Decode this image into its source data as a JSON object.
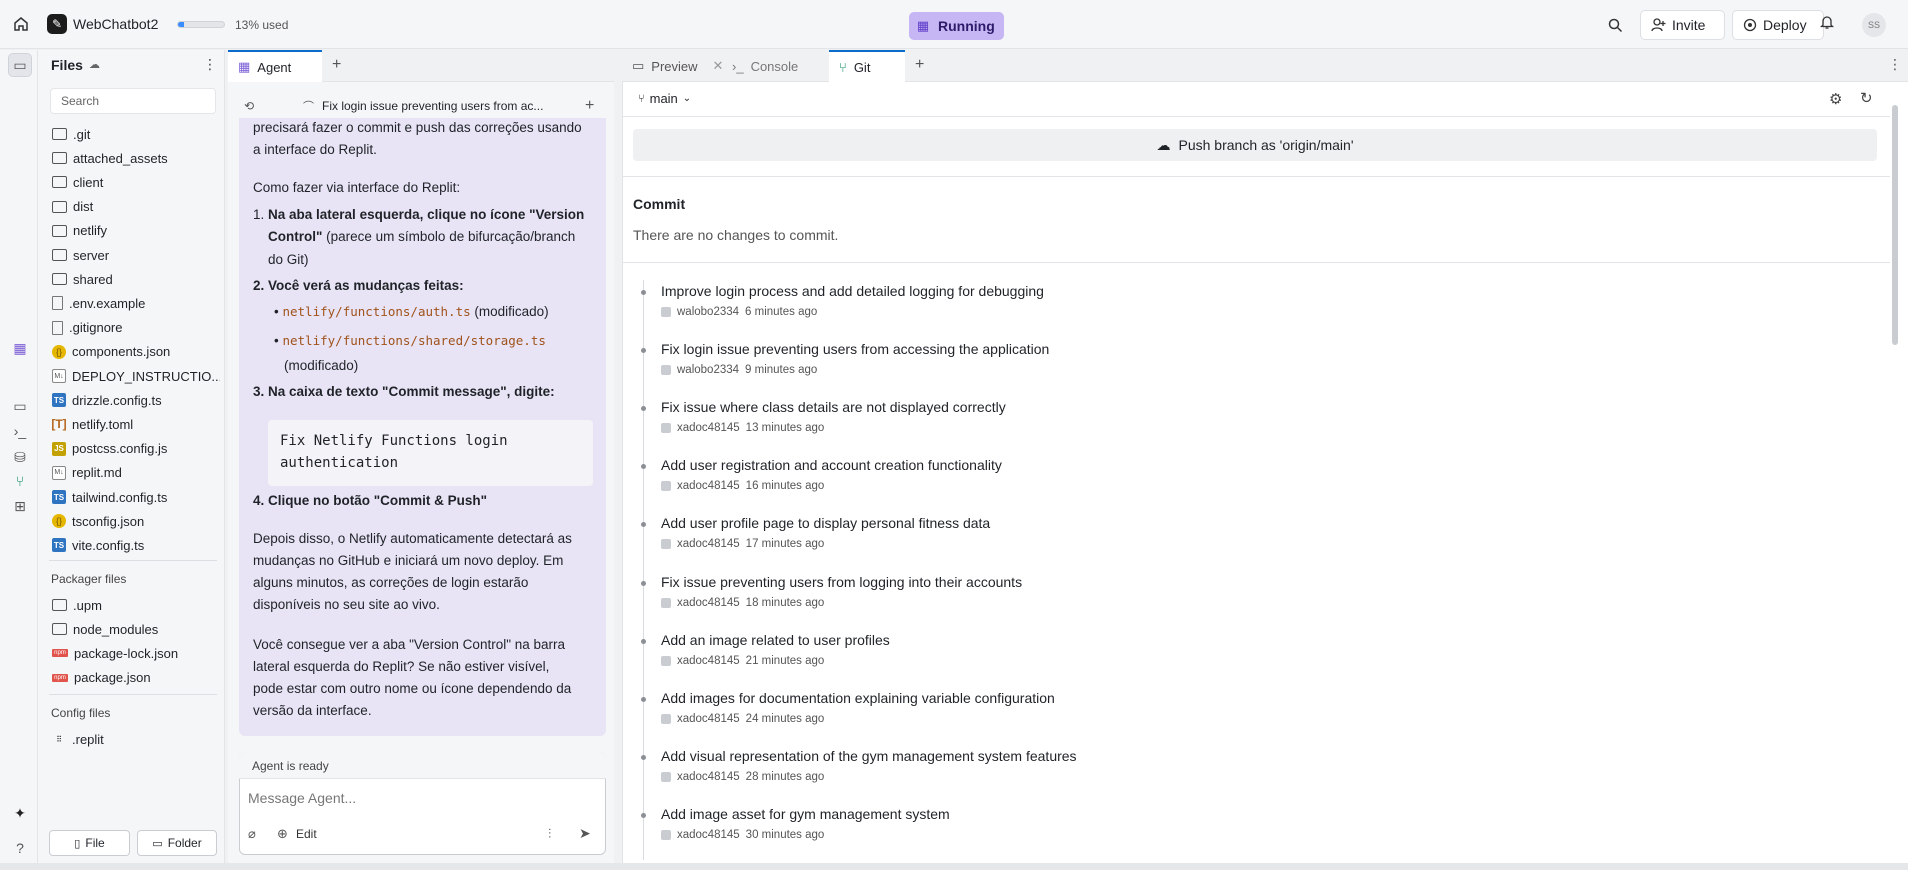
{
  "topbar": {
    "app_name": "WebChatbot2",
    "usage_text": "13% used",
    "usage_fraction": 0.13,
    "status": "Running",
    "invite": "Invite",
    "deploy": "Deploy",
    "avatar": "SS"
  },
  "files": {
    "title": "Files",
    "search_placeholder": "Search",
    "items": [
      {
        "name": ".git",
        "type": "folder"
      },
      {
        "name": "attached_assets",
        "type": "folder"
      },
      {
        "name": "client",
        "type": "folder"
      },
      {
        "name": "dist",
        "type": "folder"
      },
      {
        "name": "netlify",
        "type": "folder"
      },
      {
        "name": "server",
        "type": "folder"
      },
      {
        "name": "shared",
        "type": "folder"
      },
      {
        "name": ".env.example",
        "type": "file"
      },
      {
        "name": ".gitignore",
        "type": "file"
      },
      {
        "name": "components.json",
        "type": "json"
      },
      {
        "name": "DEPLOY_INSTRUCTIO...",
        "type": "md"
      },
      {
        "name": "drizzle.config.ts",
        "type": "ts"
      },
      {
        "name": "netlify.toml",
        "type": "toml"
      },
      {
        "name": "postcss.config.js",
        "type": "js"
      },
      {
        "name": "replit.md",
        "type": "md"
      },
      {
        "name": "tailwind.config.ts",
        "type": "ts"
      },
      {
        "name": "tsconfig.json",
        "type": "json"
      },
      {
        "name": "vite.config.ts",
        "type": "ts"
      }
    ],
    "packager_title": "Packager files",
    "packager_items": [
      {
        "name": ".upm",
        "type": "folder"
      },
      {
        "name": "node_modules",
        "type": "folder"
      },
      {
        "name": "package-lock.json",
        "type": "npm"
      },
      {
        "name": "package.json",
        "type": "npm"
      }
    ],
    "config_title": "Config files",
    "config_items": [
      {
        "name": ".replit",
        "type": "replit"
      }
    ],
    "new_file": "File",
    "new_folder": "Folder"
  },
  "agent": {
    "tab": "Agent",
    "thread_title": "Fix login issue preventing users from ac...",
    "lines": {
      "l1": "precisará fazer o commit e push das correções usando",
      "l2": "a interface do Replit.",
      "l3": "Como fazer via interface do Replit:",
      "s1a": "1. ",
      "s1b": "Na aba lateral esquerda, clique no ícone \"Version",
      "s1c": "Control\"",
      "s1d": " (parece um símbolo de bifurcação/branch",
      "s1e": "do Git)",
      "s2": "2. Você verá as mudanças feitas:",
      "c1": "netlify/functions/auth.ts",
      "c1b": " (modificado)",
      "c2": "netlify/functions/shared/storage.ts",
      "c2b": "(modificado)",
      "s3": "3. Na caixa de texto \"Commit message\", digite:",
      "code1": "Fix Netlify Functions login",
      "code2": "authentication",
      "s4": "4. Clique no botão \"Commit & Push\"",
      "p1": "Depois disso, o Netlify automaticamente detectará as",
      "p2": "mudanças no GitHub e iniciará um novo deploy. Em",
      "p3": "alguns minutos, as correções de login estarão",
      "p4": "disponíveis no seu site ao vivo.",
      "q1": "Você consegue ver a aba \"Version Control\" na barra",
      "q2": "lateral esquerda do Replit? Se não estiver visível,",
      "q3": "pode estar com outro nome ou ícone dependendo da",
      "q4": "versão da interface."
    },
    "status": "Agent is ready",
    "input_placeholder": "Message Agent...",
    "edit": "Edit"
  },
  "right": {
    "tabs": [
      "Preview",
      "Console",
      "Git"
    ],
    "branch": "main",
    "push_label": "Push branch as 'origin/main'",
    "commit_title": "Commit",
    "no_changes": "There are no changes to commit.",
    "commits": [
      {
        "title": "Improve login process and add detailed logging for debugging",
        "author": "walobo2334",
        "time": "6 minutes ago"
      },
      {
        "title": "Fix login issue preventing users from accessing the application",
        "author": "walobo2334",
        "time": "9 minutes ago"
      },
      {
        "title": "Fix issue where class details are not displayed correctly",
        "author": "xadoc48145",
        "time": "13 minutes ago"
      },
      {
        "title": "Add user registration and account creation functionality",
        "author": "xadoc48145",
        "time": "16 minutes ago"
      },
      {
        "title": "Add user profile page to display personal fitness data",
        "author": "xadoc48145",
        "time": "17 minutes ago"
      },
      {
        "title": "Fix issue preventing users from logging into their accounts",
        "author": "xadoc48145",
        "time": "18 minutes ago"
      },
      {
        "title": "Add an image related to user profiles",
        "author": "xadoc48145",
        "time": "21 minutes ago"
      },
      {
        "title": "Add images for documentation explaining variable configuration",
        "author": "xadoc48145",
        "time": "24 minutes ago"
      },
      {
        "title": "Add visual representation of the gym management system features",
        "author": "xadoc48145",
        "time": "28 minutes ago"
      },
      {
        "title": "Add image asset for gym management system",
        "author": "xadoc48145",
        "time": "30 minutes ago"
      }
    ]
  }
}
